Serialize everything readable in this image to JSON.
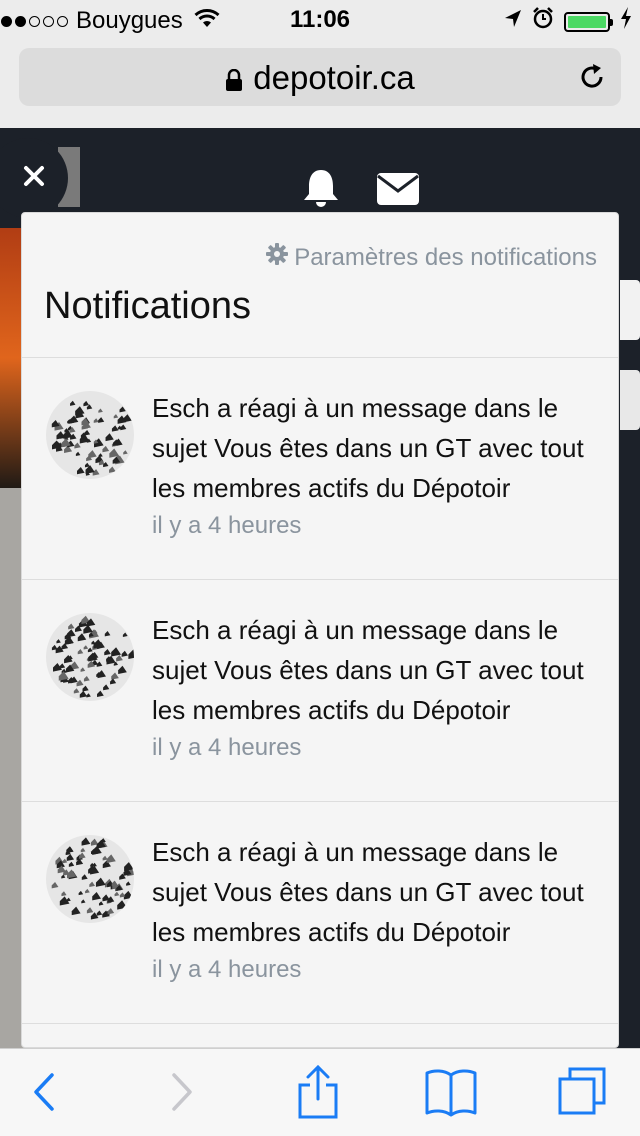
{
  "status_bar": {
    "carrier": "Bouygues",
    "time": "11:06",
    "signal_bars": 2,
    "signal_total": 5,
    "battery_level": 1.0,
    "battery_color": "#4cd964"
  },
  "browser": {
    "url": "depotoir.ca",
    "icons": [
      "lock-icon",
      "reload-icon"
    ]
  },
  "page": {
    "close_icon": "close-icon",
    "bell_icon": "bell-icon",
    "mail_icon": "mail-icon"
  },
  "notifications_panel": {
    "settings_link": "Paramètres des notifications",
    "title": "Notifications",
    "items": [
      {
        "text": "Esch a réagi à un message dans le sujet Vous êtes dans un GT avec tout les membres actifs du Dépotoir",
        "time": "il y a 4 heures"
      },
      {
        "text": "Esch a réagi à un message dans le sujet Vous êtes dans un GT avec tout les membres actifs du Dépotoir",
        "time": "il y a 4 heures"
      },
      {
        "text": "Esch a réagi à un message dans le sujet Vous êtes dans un GT avec tout les membres actifs du Dépotoir",
        "time": "il y a 4 heures"
      }
    ]
  },
  "toolbar": {
    "icons": [
      "back-icon",
      "forward-icon",
      "share-icon",
      "bookmarks-icon",
      "tabs-icon"
    ],
    "accent_color": "#1a7cf5"
  }
}
